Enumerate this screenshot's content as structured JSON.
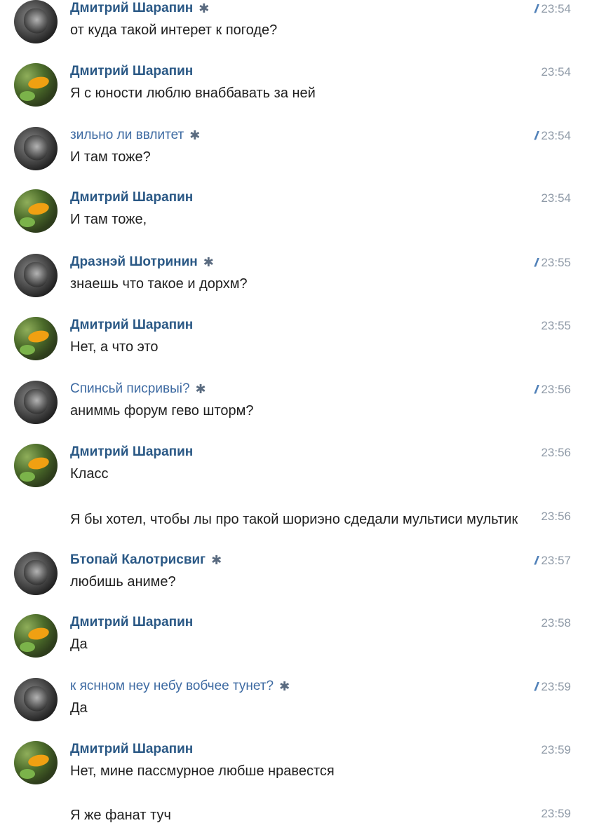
{
  "messages": [
    {
      "name": "Дмитрий Шарапин",
      "text": "от куда такой интерет к погоде?",
      "time": "23:54",
      "read": true
    },
    {
      "name": "Дмитрий Шарапин",
      "text": "Я с юности люблю внаббавать за ней",
      "time": "23:54",
      "read": false
    },
    {
      "name": "зильно ли ввлитет",
      "text": "И там тоже?",
      "time": "23:54",
      "read": true
    },
    {
      "name": "Дмитрий Шарапин",
      "text": "И там тоже,",
      "time": "23:54",
      "read": false
    },
    {
      "name": "Дразнэй Шотринин",
      "text": "знаешь что такое и дорхм?",
      "time": "23:55",
      "read": true
    },
    {
      "name": "Дмитрий Шарапин",
      "text": "Нет, а что это",
      "time": "23:55",
      "read": false
    },
    {
      "name": "Спинсьй писривыі?",
      "text": "аниммь форум гево шторм?",
      "time": "23:56",
      "read": true
    },
    {
      "name": "Дмитрий Шарапин",
      "text": "Класс",
      "time": "23:56",
      "read": false
    },
    {
      "name": "",
      "text": "Я бы хотел, чтобы лы про такой шориэно сдедали мультиси мультик",
      "time": "23:56",
      "read": false
    },
    {
      "name": "Бтопай Калотрисвиг",
      "text": "любишь аниме?",
      "time": "23:57",
      "read": true
    },
    {
      "name": "Дмитрий Шарапин",
      "text": "Да",
      "time": "23:58",
      "read": false
    },
    {
      "name": "к яснном неу небу вобчее тунет?",
      "text": "Да",
      "time": "23:59",
      "read": true
    },
    {
      "name": "Дмитрий Шарапин",
      "text": "Нет, мине пассмурное любше нравестся",
      "time": "23:59",
      "read": false
    },
    {
      "name": "",
      "text": "Я же фанат туч",
      "time": "23:59",
      "read": false
    }
  ],
  "icons": {
    "spider": "spider-icon",
    "read_receipt": "double-check-icon"
  },
  "glyphs": {
    "spider": "✱",
    "check": "//"
  },
  "colors": {
    "name": "#2a5885",
    "time": "#8f9aa7",
    "check": "#5181b8"
  }
}
